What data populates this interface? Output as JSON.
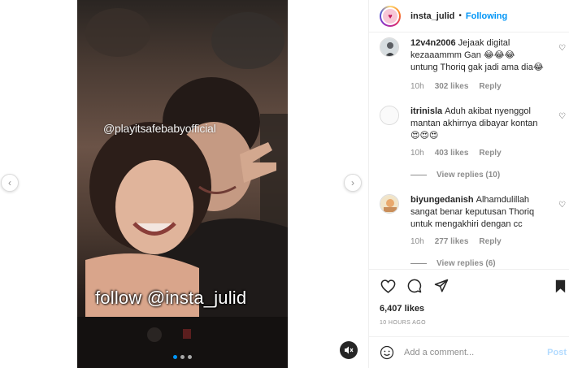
{
  "media": {
    "watermark": "@playitsafebabyofficial",
    "overlay_caption": "follow @insta_julid",
    "carousel": {
      "count": 3,
      "active_index": 0
    }
  },
  "header": {
    "username": "insta_julid",
    "separator": "•",
    "follow_status": "Following"
  },
  "comments": [
    {
      "username": "12v4n2006",
      "text": "Jejaak digital kezaaammm Gan 😂😂😂 untung Thoriq gak jadi ama dia😂",
      "time": "10h",
      "likes": "302 likes",
      "reply": "Reply"
    },
    {
      "username": "itrinisla",
      "text": "Aduh akibat nyenggol mantan akhirnya dibayar kontan 😍😍😍",
      "time": "10h",
      "likes": "403 likes",
      "reply": "Reply",
      "view_replies": "View replies (10)"
    },
    {
      "username": "biyungedanish",
      "text": "Alhamdulillah sangat benar keputusan Thoriq untuk mengakhiri dengan cc",
      "time": "10h",
      "likes": "277 likes",
      "reply": "Reply",
      "view_replies": "View replies (6)"
    }
  ],
  "post": {
    "likes": "6,407 likes",
    "posted": "10 HOURS AGO"
  },
  "add_comment": {
    "placeholder": "Add a comment...",
    "post_label": "Post"
  },
  "icons": [
    "chevron-left-icon",
    "chevron-right-icon",
    "mute-icon",
    "heart-icon",
    "comment-icon",
    "share-icon",
    "bookmark-icon",
    "emoji-icon"
  ],
  "colors": {
    "accent": "#0095f6",
    "post_disabled": "#b3dbff",
    "muted": "#8e8e8e"
  }
}
